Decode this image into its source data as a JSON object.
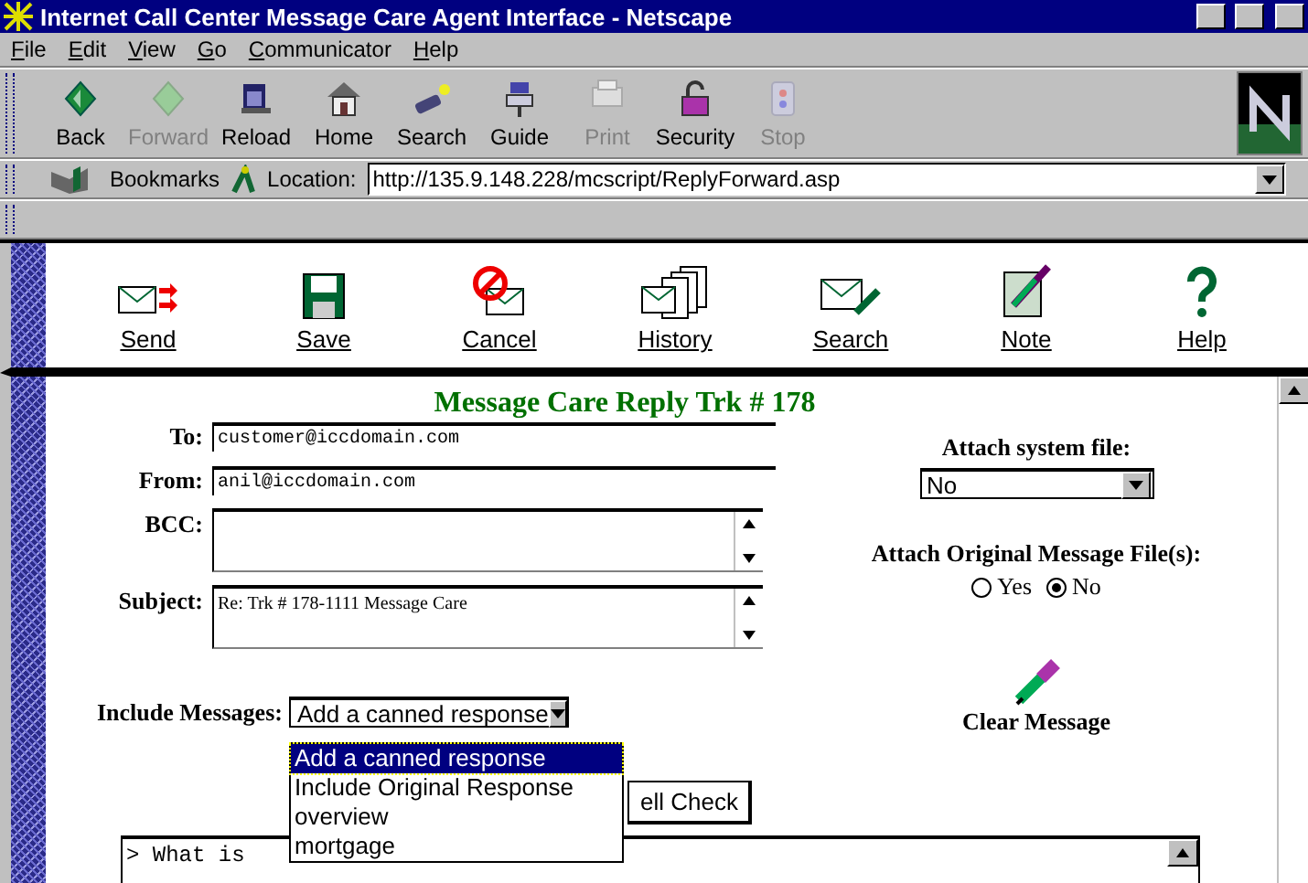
{
  "window": {
    "title": "Internet Call Center Message Care Agent Interface - Netscape"
  },
  "menu": [
    {
      "label": "File"
    },
    {
      "label": "Edit"
    },
    {
      "label": "View"
    },
    {
      "label": "Go"
    },
    {
      "label": "Communicator"
    },
    {
      "label": "Help"
    }
  ],
  "nav_buttons": [
    {
      "label": "Back",
      "disabled": false
    },
    {
      "label": "Forward",
      "disabled": true
    },
    {
      "label": "Reload",
      "disabled": false
    },
    {
      "label": "Home",
      "disabled": false
    },
    {
      "label": "Search",
      "disabled": false
    },
    {
      "label": "Guide",
      "disabled": false
    },
    {
      "label": "Print",
      "disabled": true
    },
    {
      "label": "Security",
      "disabled": false
    },
    {
      "label": "Stop",
      "disabled": true
    }
  ],
  "location_bar": {
    "bookmarks": "Bookmarks",
    "label": "Location:",
    "url": "http://135.9.148.228/mcscript/ReplyForward.asp"
  },
  "page_toolbar": [
    {
      "label": "Send"
    },
    {
      "label": "Save"
    },
    {
      "label": "Cancel"
    },
    {
      "label": "History"
    },
    {
      "label": "Search"
    },
    {
      "label": "Note"
    },
    {
      "label": "Help"
    }
  ],
  "form": {
    "heading": "Message Care Reply Trk # 178",
    "fields": [
      {
        "label": "To:",
        "kind": "line",
        "value": "customer@iccdomain.com"
      },
      {
        "label": "From:",
        "kind": "line",
        "value": "anil@iccdomain.com"
      },
      {
        "label": "BCC:",
        "kind": "area"
      },
      {
        "label": "Subject:",
        "kind": "area",
        "value": "Re: Trk # 178-1111 Message Care"
      }
    ],
    "attach_system_file": {
      "label": "Attach system file:",
      "value": "No"
    },
    "attach_original": {
      "label": "Attach Original Message File(s):",
      "options": [
        {
          "label": "Yes",
          "selected": false
        },
        {
          "label": "No",
          "selected": true
        }
      ]
    },
    "clear_message": "Clear Message",
    "include_messages": {
      "label": "Include Messages:",
      "value": "Add a canned response",
      "expanded": true,
      "options": [
        {
          "label": "Add a canned response",
          "selected": true
        },
        {
          "label": "Include Original Response",
          "selected": false
        },
        {
          "label": "overview",
          "selected": false
        },
        {
          "label": "mortgage",
          "selected": false
        }
      ]
    },
    "spell_check": "ell Check",
    "body": "> What is"
  }
}
